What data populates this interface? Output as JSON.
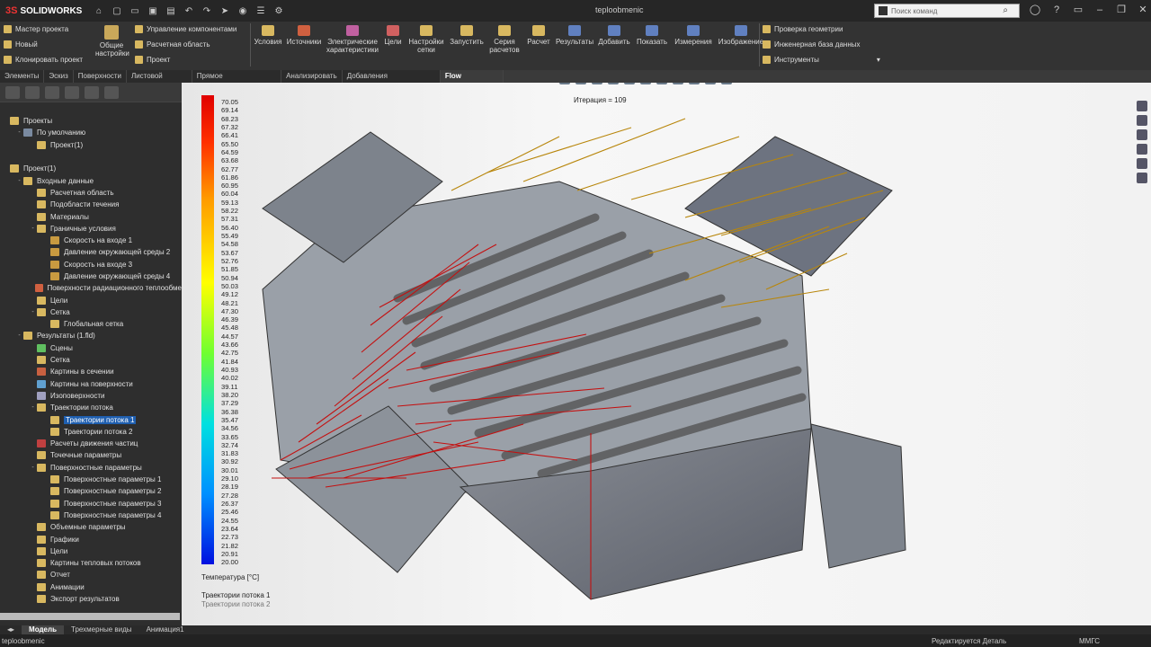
{
  "app": {
    "name": "SOLIDWORKS",
    "doc_title": "teploobmenic",
    "search_placeholder": "Поиск команд"
  },
  "ribbon": {
    "left": [
      "Мастер проекта",
      "Новый",
      "Клонировать проект"
    ],
    "general": "Общие настройки",
    "mid": [
      "Управление компонентами",
      "Расчетная область",
      "Проект"
    ],
    "tools": [
      "Условия",
      "Источники",
      "Электрические характеристики",
      "Цели",
      "Настройки сетки",
      "Запустить",
      "Серия расчетов",
      "Расчет",
      "Результаты",
      "Добавить",
      "Показать",
      "Измерения",
      "Изображение"
    ],
    "right": [
      "Проверка геометрии",
      "Инженерная база данных",
      "Инструменты"
    ]
  },
  "tabs": [
    "Элементы",
    "Эскиз",
    "Поверхности",
    "Листовой металл",
    "Прямое редактирование",
    "Анализировать",
    "Добавления SOLIDWORKS",
    "Flow Simulation"
  ],
  "active_tab": "Flow Simulation",
  "tree": [
    {
      "label": "Проекты",
      "level": 0,
      "toggle": "",
      "color": "#d8b860"
    },
    {
      "label": "По умолчанию",
      "level": 1,
      "toggle": "-",
      "color": "#7a8aa0"
    },
    {
      "label": "Проект(1)",
      "level": 2,
      "toggle": "",
      "color": "#d8b860"
    },
    {
      "label": "",
      "level": 0,
      "toggle": "",
      "color": ""
    },
    {
      "label": "Проект(1)",
      "level": 0,
      "toggle": "",
      "color": "#d8b860"
    },
    {
      "label": "Входные данные",
      "level": 1,
      "toggle": "-",
      "color": "#d8b860"
    },
    {
      "label": "Расчетная область",
      "level": 2,
      "toggle": "",
      "color": "#d8b860"
    },
    {
      "label": "Подобласти течения",
      "level": 2,
      "toggle": "",
      "color": "#d8b860"
    },
    {
      "label": "Материалы",
      "level": 2,
      "toggle": "",
      "color": "#d8b860"
    },
    {
      "label": "Граничные условия",
      "level": 2,
      "toggle": "-",
      "color": "#d8b860"
    },
    {
      "label": "Скорость на входе 1",
      "level": 3,
      "toggle": "",
      "color": "#c89a40"
    },
    {
      "label": "Давление окружающей среды 2",
      "level": 3,
      "toggle": "",
      "color": "#c89a40"
    },
    {
      "label": "Скорость на входе 3",
      "level": 3,
      "toggle": "",
      "color": "#c89a40"
    },
    {
      "label": "Давление окружающей среды 4",
      "level": 3,
      "toggle": "",
      "color": "#c89a40"
    },
    {
      "label": "Поверхности радиационного теплообме",
      "level": 2,
      "toggle": "",
      "color": "#d06040"
    },
    {
      "label": "Цели",
      "level": 2,
      "toggle": "",
      "color": "#d8b860"
    },
    {
      "label": "Сетка",
      "level": 2,
      "toggle": "-",
      "color": "#d8b860"
    },
    {
      "label": "Глобальная сетка",
      "level": 3,
      "toggle": "",
      "color": "#d8b860"
    },
    {
      "label": "Результаты (1.fld)",
      "level": 1,
      "toggle": "-",
      "color": "#d8b860"
    },
    {
      "label": "Сцены",
      "level": 2,
      "toggle": "",
      "color": "#60c060"
    },
    {
      "label": "Сетка",
      "level": 2,
      "toggle": "",
      "color": "#d8b860"
    },
    {
      "label": "Картины в сечении",
      "level": 2,
      "toggle": "",
      "color": "#c86040"
    },
    {
      "label": "Картины на поверхности",
      "level": 2,
      "toggle": "",
      "color": "#60a0d0"
    },
    {
      "label": "Изоповерхности",
      "level": 2,
      "toggle": "",
      "color": "#a0a0c0"
    },
    {
      "label": "Траектории потока",
      "level": 2,
      "toggle": "-",
      "color": "#d8b860"
    },
    {
      "label": "Траектории потока 1",
      "level": 3,
      "toggle": "",
      "color": "#d8b860",
      "selected": true
    },
    {
      "label": "Траектории потока 2",
      "level": 3,
      "toggle": "",
      "color": "#d8b860"
    },
    {
      "label": "Расчеты движения частиц",
      "level": 2,
      "toggle": "",
      "color": "#c04040"
    },
    {
      "label": "Точечные параметры",
      "level": 2,
      "toggle": "",
      "color": "#d8b860"
    },
    {
      "label": "Поверхностные параметры",
      "level": 2,
      "toggle": "-",
      "color": "#d8b860"
    },
    {
      "label": "Поверхностные параметры 1",
      "level": 3,
      "toggle": "",
      "color": "#d8b860"
    },
    {
      "label": "Поверхностные параметры 2",
      "level": 3,
      "toggle": "",
      "color": "#d8b860"
    },
    {
      "label": "Поверхностные параметры 3",
      "level": 3,
      "toggle": "",
      "color": "#d8b860"
    },
    {
      "label": "Поверхностные параметры 4",
      "level": 3,
      "toggle": "",
      "color": "#d8b860"
    },
    {
      "label": "Объемные параметры",
      "level": 2,
      "toggle": "",
      "color": "#d8b860"
    },
    {
      "label": "Графики",
      "level": 2,
      "toggle": "",
      "color": "#d8b860"
    },
    {
      "label": "Цели",
      "level": 2,
      "toggle": "",
      "color": "#d8b860"
    },
    {
      "label": "Картины тепловых потоков",
      "level": 2,
      "toggle": "",
      "color": "#d8b860"
    },
    {
      "label": "Отчет",
      "level": 2,
      "toggle": "",
      "color": "#d8b860"
    },
    {
      "label": "Анимации",
      "level": 2,
      "toggle": "",
      "color": "#d8b860"
    },
    {
      "label": "Экспорт результатов",
      "level": 2,
      "toggle": "",
      "color": "#d8b860"
    }
  ],
  "viewport": {
    "iteration": "Итерация = 109",
    "legend_title": "Температура [°C]",
    "legend_ticks": [
      "70.05",
      "69.14",
      "68.23",
      "67.32",
      "66.41",
      "65.50",
      "64.59",
      "63.68",
      "62.77",
      "61.86",
      "60.95",
      "60.04",
      "59.13",
      "58.22",
      "57.31",
      "56.40",
      "55.49",
      "54.58",
      "53.67",
      "52.76",
      "51.85",
      "50.94",
      "50.03",
      "49.12",
      "48.21",
      "47.30",
      "46.39",
      "45.48",
      "44.57",
      "43.66",
      "42.75",
      "41.84",
      "40.93",
      "40.02",
      "39.11",
      "38.20",
      "37.29",
      "36.38",
      "35.47",
      "34.56",
      "33.65",
      "32.74",
      "31.83",
      "30.92",
      "30.01",
      "29.10",
      "28.19",
      "27.28",
      "26.37",
      "25.46",
      "24.55",
      "23.64",
      "22.73",
      "21.82",
      "20.91",
      "20.00"
    ],
    "traj1": "Траектории потока 1",
    "traj2": "Траектории потока 2"
  },
  "bottom_tabs": [
    "Модель",
    "Трехмерные виды",
    "Анимация1"
  ],
  "status": {
    "file": "teploobmenic",
    "edit": "Редактируется Деталь",
    "units": "ММГС"
  }
}
